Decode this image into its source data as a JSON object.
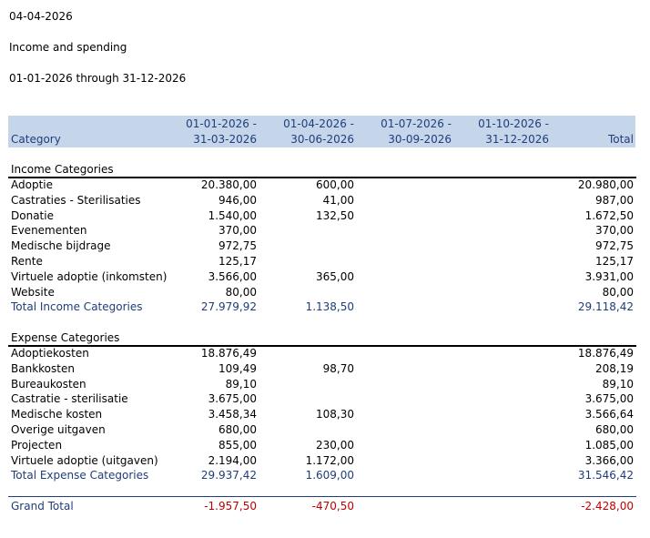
{
  "report": {
    "date": "04-04-2026",
    "title": "Income and spending",
    "range": "01-01-2026 through 31-12-2026"
  },
  "columns": {
    "category": "Category",
    "periods": [
      {
        "line1": "01-01-2026 -",
        "line2": "31-03-2026"
      },
      {
        "line1": "01-04-2026 -",
        "line2": "30-06-2026"
      },
      {
        "line1": "01-07-2026 -",
        "line2": "30-09-2026"
      },
      {
        "line1": "01-10-2026 -",
        "line2": "31-12-2026"
      }
    ],
    "total": "Total"
  },
  "income": {
    "title": "Income Categories",
    "rows": [
      {
        "category": "Adoptie",
        "q1": "20.380,00",
        "q2": "600,00",
        "q3": "",
        "q4": "",
        "total": "20.980,00"
      },
      {
        "category": "Castraties - Sterilisaties",
        "q1": "946,00",
        "q2": "41,00",
        "q3": "",
        "q4": "",
        "total": "987,00"
      },
      {
        "category": "Donatie",
        "q1": "1.540,00",
        "q2": "132,50",
        "q3": "",
        "q4": "",
        "total": "1.672,50"
      },
      {
        "category": "Evenementen",
        "q1": "370,00",
        "q2": "",
        "q3": "",
        "q4": "",
        "total": "370,00"
      },
      {
        "category": "Medische bijdrage",
        "q1": "972,75",
        "q2": "",
        "q3": "",
        "q4": "",
        "total": "972,75"
      },
      {
        "category": "Rente",
        "q1": "125,17",
        "q2": "",
        "q3": "",
        "q4": "",
        "total": "125,17"
      },
      {
        "category": "Virtuele adoptie (inkomsten)",
        "q1": "3.566,00",
        "q2": "365,00",
        "q3": "",
        "q4": "",
        "total": "3.931,00"
      },
      {
        "category": "Website",
        "q1": "80,00",
        "q2": "",
        "q3": "",
        "q4": "",
        "total": "80,00"
      }
    ],
    "total": {
      "category": "Total Income Categories",
      "q1": "27.979,92",
      "q2": "1.138,50",
      "q3": "",
      "q4": "",
      "total": "29.118,42"
    }
  },
  "expense": {
    "title": "Expense Categories",
    "rows": [
      {
        "category": "Adoptiekosten",
        "q1": "18.876,49",
        "q2": "",
        "q3": "",
        "q4": "",
        "total": "18.876,49"
      },
      {
        "category": "Bankkosten",
        "q1": "109,49",
        "q2": "98,70",
        "q3": "",
        "q4": "",
        "total": "208,19"
      },
      {
        "category": "Bureaukosten",
        "q1": "89,10",
        "q2": "",
        "q3": "",
        "q4": "",
        "total": "89,10"
      },
      {
        "category": "Castratie - sterilisatie",
        "q1": "3.675,00",
        "q2": "",
        "q3": "",
        "q4": "",
        "total": "3.675,00"
      },
      {
        "category": "Medische kosten",
        "q1": "3.458,34",
        "q2": "108,30",
        "q3": "",
        "q4": "",
        "total": "3.566,64"
      },
      {
        "category": "Overige uitgaven",
        "q1": "680,00",
        "q2": "",
        "q3": "",
        "q4": "",
        "total": "680,00"
      },
      {
        "category": "Projecten",
        "q1": "855,00",
        "q2": "230,00",
        "q3": "",
        "q4": "",
        "total": "1.085,00"
      },
      {
        "category": "Virtuele adoptie (uitgaven)",
        "q1": "2.194,00",
        "q2": "1.172,00",
        "q3": "",
        "q4": "",
        "total": "3.366,00"
      }
    ],
    "total": {
      "category": "Total Expense Categories",
      "q1": "29.937,42",
      "q2": "1.609,00",
      "q3": "",
      "q4": "",
      "total": "31.546,42"
    }
  },
  "grand_total": {
    "category": "Grand Total",
    "q1": "-1.957,50",
    "q2": "-470,50",
    "q3": "",
    "q4": "",
    "total": "-2.428,00"
  },
  "colors": {
    "header_bg": "#c6d6ea",
    "header_text": "#1f3d7a",
    "total_text": "#1f3d7a",
    "negative": "#c00000"
  }
}
